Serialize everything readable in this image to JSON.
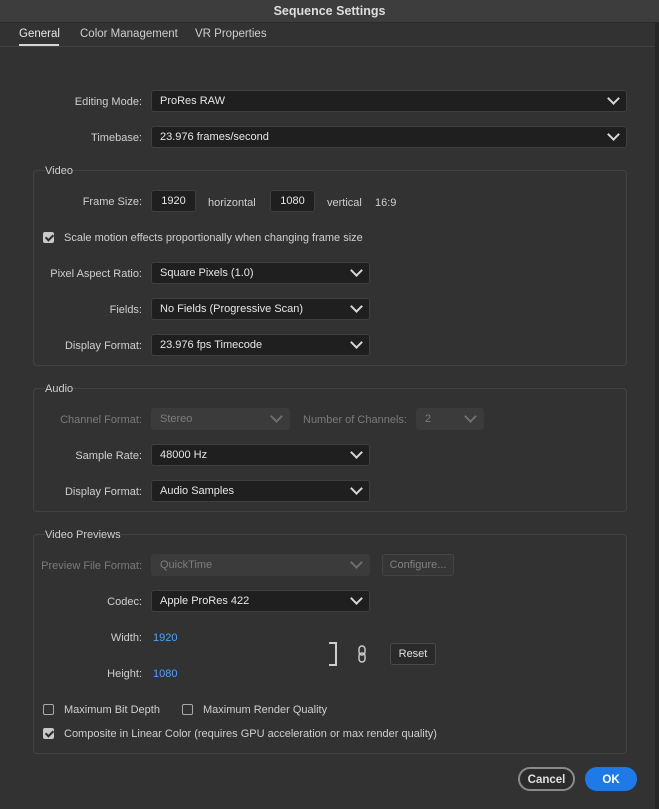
{
  "window": {
    "title": "Sequence Settings"
  },
  "tabs": [
    {
      "label": "General"
    },
    {
      "label": "Color Management"
    },
    {
      "label": "VR Properties"
    }
  ],
  "general": {
    "editing_mode": {
      "label": "Editing Mode:",
      "value": "ProRes RAW"
    },
    "timebase": {
      "label": "Timebase:",
      "value": "23.976  frames/second"
    }
  },
  "video": {
    "title": "Video",
    "frame_size": {
      "label": "Frame Size:",
      "horizontal_value": "1920",
      "horizontal_label": "horizontal",
      "vertical_value": "1080",
      "vertical_label": "vertical",
      "aspect": "16:9"
    },
    "scale_motion": {
      "label": "Scale motion effects proportionally when changing frame size",
      "checked": true
    },
    "pixel_aspect_ratio": {
      "label": "Pixel Aspect Ratio:",
      "value": "Square Pixels (1.0)"
    },
    "fields": {
      "label": "Fields:",
      "value": "No Fields (Progressive Scan)"
    },
    "display_format": {
      "label": "Display Format:",
      "value": "23.976 fps Timecode"
    }
  },
  "audio": {
    "title": "Audio",
    "channel_format": {
      "label": "Channel Format:",
      "value": "Stereo"
    },
    "number_of_channels": {
      "label": "Number of Channels:",
      "value": "2"
    },
    "sample_rate": {
      "label": "Sample Rate:",
      "value": "48000 Hz"
    },
    "display_format": {
      "label": "Display Format:",
      "value": "Audio Samples"
    }
  },
  "previews": {
    "title": "Video Previews",
    "preview_file_format": {
      "label": "Preview File Format:",
      "value": "QuickTime"
    },
    "configure_label": "Configure...",
    "codec": {
      "label": "Codec:",
      "value": "Apple ProRes 422"
    },
    "width": {
      "label": "Width:",
      "value": "1920"
    },
    "height": {
      "label": "Height:",
      "value": "1080"
    },
    "reset_label": "Reset",
    "max_bit_depth": {
      "label": "Maximum Bit Depth",
      "checked": false
    },
    "max_render_quality": {
      "label": "Maximum Render Quality",
      "checked": false
    },
    "composite_linear": {
      "label": "Composite in Linear Color (requires GPU acceleration or max render quality)",
      "checked": true
    }
  },
  "footer": {
    "cancel_label": "Cancel",
    "ok_label": "OK"
  },
  "colors": {
    "accent": "#1f7ae8",
    "link": "#4ea2ff",
    "background": "#323232"
  }
}
